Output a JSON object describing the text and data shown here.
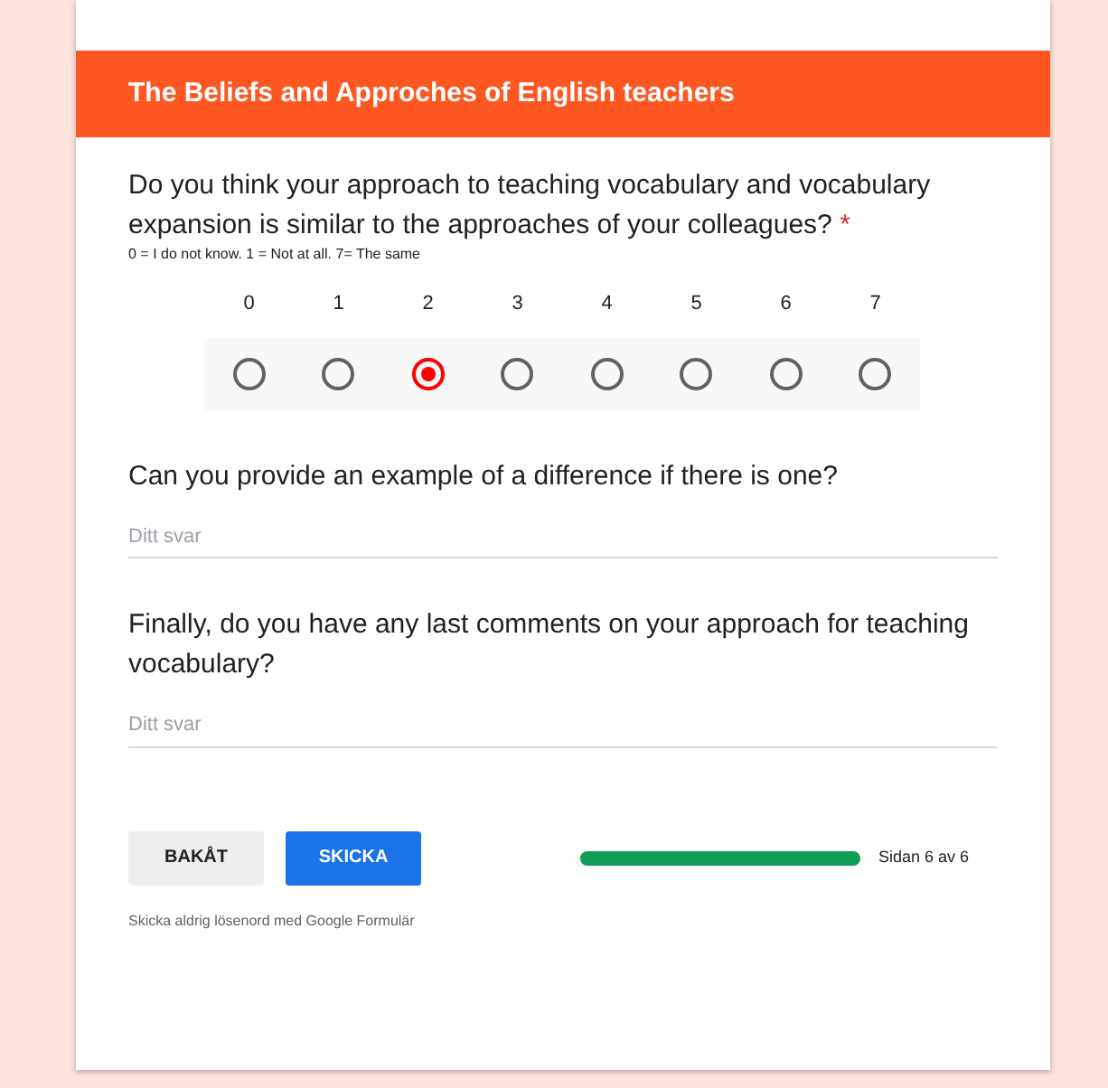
{
  "section_title": "The Beliefs and Approches of English teachers",
  "scale_question": {
    "text": "Do you think your approach to teaching vocabulary and vocabulary expansion is similar to the approaches of your colleagues?",
    "required_mark": "*",
    "hint": "0 = I do not know. 1 = Not at all. 7= The same",
    "options": [
      {
        "label": "0",
        "selected": false
      },
      {
        "label": "1",
        "selected": false
      },
      {
        "label": "2",
        "selected": true
      },
      {
        "label": "3",
        "selected": false
      },
      {
        "label": "4",
        "selected": false
      },
      {
        "label": "5",
        "selected": false
      },
      {
        "label": "6",
        "selected": false
      },
      {
        "label": "7",
        "selected": false
      }
    ]
  },
  "text_questions": [
    {
      "text": "Can you provide an example of a difference if there is one?",
      "placeholder": "Ditt svar"
    },
    {
      "text": "Finally, do you have any last comments on your approach for teaching vocabulary?",
      "placeholder": "Ditt svar"
    }
  ],
  "buttons": [
    {
      "label": "BAKÅT",
      "kind": "secondary"
    },
    {
      "label": "SKICKA",
      "kind": "primary"
    }
  ],
  "progress": {
    "level": 1,
    "label": "Sidan 6 av 6"
  },
  "footer_note": "Skicka aldrig lösenord med Google Formulär"
}
